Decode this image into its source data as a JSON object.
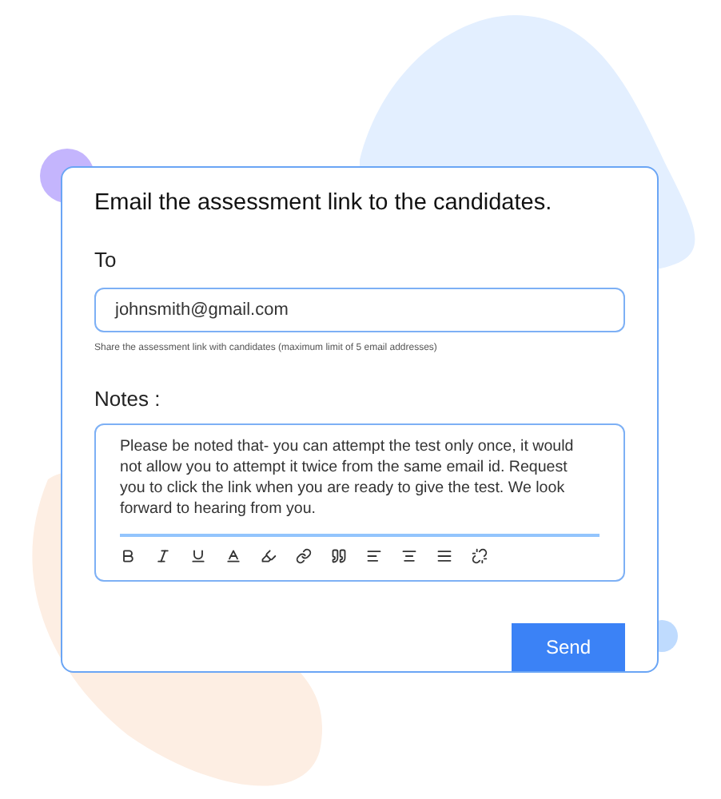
{
  "title": "Email the assessment link to the candidates.",
  "to": {
    "label": "To",
    "value": "johnsmith@gmail.com",
    "hint": "Share the assessment link with candidates (maximum limit of 5 email addresses)"
  },
  "notes": {
    "label": "Notes :",
    "value": "Please be noted that- you can attempt the test only once, it would not allow you to attempt it twice from the same email id. Request you to click the link when you are ready to give the test. We look forward to hearing from you."
  },
  "send_button": "Send"
}
